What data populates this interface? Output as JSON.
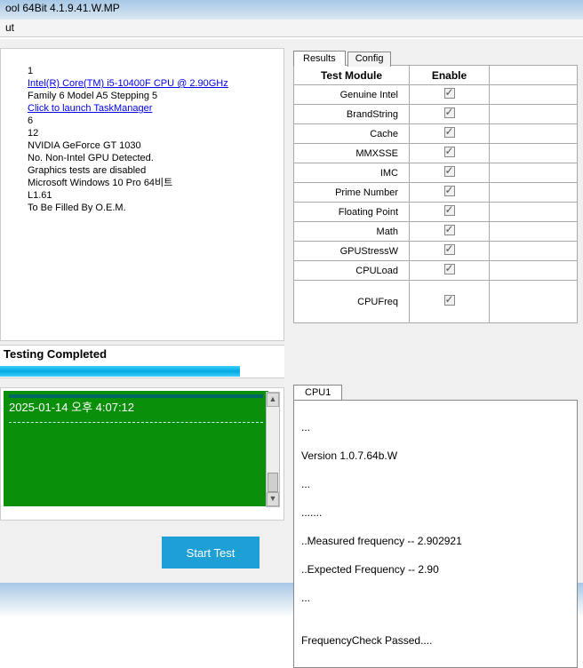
{
  "window": {
    "title": "ool 64Bit 4.1.9.41.W.MP",
    "menu": "ut"
  },
  "info": {
    "line1": "1",
    "cpu_link": "Intel(R) Core(TM) i5-10400F CPU @ 2.90GHz",
    "family": "Family 6 Model A5 Stepping 5",
    "taskmgr_link": "Click to launch TaskManager",
    "line5": "6",
    "line6": "12",
    "gpu": "NVIDIA GeForce GT 1030",
    "gpu_note": "No. Non-Intel GPU Detected.",
    "gfx_disabled": "Graphics tests are disabled",
    "os": "Microsoft Windows 10 Pro 64비트",
    "l1": "L1.61",
    "oem": "To Be Filled By O.E.M."
  },
  "tabs": {
    "results": "Results",
    "config": "Config",
    "col_module": "Test Module",
    "col_enable": "Enable",
    "rows": [
      "Genuine Intel",
      "BrandString",
      "Cache",
      "MMXSSE",
      "IMC",
      "Prime Number",
      "Floating Point",
      "Math",
      "GPUStressW",
      "CPULoad",
      "CPUFreq"
    ]
  },
  "status": {
    "text": "Testing Completed"
  },
  "console": {
    "line1": "",
    "timestamp": "2025-01-14 오후 4:07:12"
  },
  "buttons": {
    "start": "Start Test"
  },
  "cpu": {
    "tab": "CPU1",
    "l1": "...",
    "version": "Version 1.0.7.64b.W",
    "l3": "...",
    "l4": ".......",
    "meas": "..Measured frequency -- 2.902921",
    "exp": "..Expected Frequency -- 2.90",
    "l7": "...",
    "blank": " ",
    "passed": "FrequencyCheck Passed...."
  }
}
